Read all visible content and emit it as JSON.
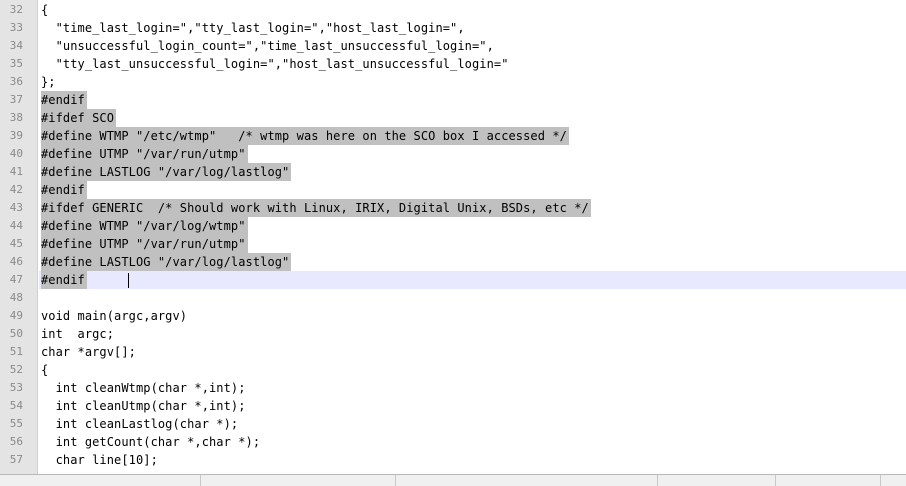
{
  "editor": {
    "selection_color": "#c0c0c0",
    "current_line_color": "#e8e8ff",
    "lines": [
      {
        "number": "32",
        "text": "{",
        "selected": false,
        "current": false
      },
      {
        "number": "33",
        "text": "  \"time_last_login=\",\"tty_last_login=\",\"host_last_login=\",",
        "selected": false,
        "current": false
      },
      {
        "number": "34",
        "text": "  \"unsuccessful_login_count=\",\"time_last_unsuccessful_login=\",",
        "selected": false,
        "current": false
      },
      {
        "number": "35",
        "text": "  \"tty_last_unsuccessful_login=\",\"host_last_unsuccessful_login=\"",
        "selected": false,
        "current": false
      },
      {
        "number": "36",
        "text": "};",
        "selected": false,
        "current": false
      },
      {
        "number": "37",
        "text": "#endif",
        "selected": true,
        "current": false
      },
      {
        "number": "38",
        "text": "#ifdef SCO",
        "selected": true,
        "current": false
      },
      {
        "number": "39",
        "text": "#define WTMP \"/etc/wtmp\"   /* wtmp was here on the SCO box I accessed */",
        "selected": true,
        "current": false
      },
      {
        "number": "40",
        "text": "#define UTMP \"/var/run/utmp\"",
        "selected": true,
        "current": false
      },
      {
        "number": "41",
        "text": "#define LASTLOG \"/var/log/lastlog\"",
        "selected": true,
        "current": false
      },
      {
        "number": "42",
        "text": "#endif",
        "selected": true,
        "current": false
      },
      {
        "number": "43",
        "text": "#ifdef GENERIC  /* Should work with Linux, IRIX, Digital Unix, BSDs, etc */",
        "selected": true,
        "current": false
      },
      {
        "number": "44",
        "text": "#define WTMP \"/var/log/wtmp\"",
        "selected": true,
        "current": false
      },
      {
        "number": "45",
        "text": "#define UTMP \"/var/run/utmp\"",
        "selected": true,
        "current": false
      },
      {
        "number": "46",
        "text": "#define LASTLOG \"/var/log/lastlog\"",
        "selected": true,
        "current": false
      },
      {
        "number": "47",
        "text": "#endif",
        "selected": true,
        "current": true
      },
      {
        "number": "48",
        "text": "",
        "selected": false,
        "current": false
      },
      {
        "number": "49",
        "text": "void main(argc,argv)",
        "selected": false,
        "current": false
      },
      {
        "number": "50",
        "text": "int  argc;",
        "selected": false,
        "current": false
      },
      {
        "number": "51",
        "text": "char *argv[];",
        "selected": false,
        "current": false
      },
      {
        "number": "52",
        "text": "{",
        "selected": false,
        "current": false
      },
      {
        "number": "53",
        "text": "  int cleanWtmp(char *,int);",
        "selected": false,
        "current": false
      },
      {
        "number": "54",
        "text": "  int cleanUtmp(char *,int);",
        "selected": false,
        "current": false
      },
      {
        "number": "55",
        "text": "  int cleanLastlog(char *);",
        "selected": false,
        "current": false
      },
      {
        "number": "56",
        "text": "  int getCount(char *,char *);",
        "selected": false,
        "current": false
      },
      {
        "number": "57",
        "text": "  char line[10];",
        "selected": false,
        "current": false
      }
    ]
  }
}
